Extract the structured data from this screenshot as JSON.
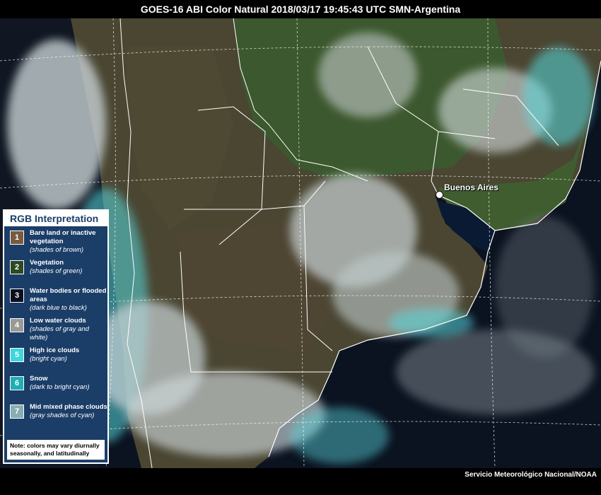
{
  "title": "GOES-16 ABI Color Natural 2018/03/17 19:45:43 UTC SMN-Argentina",
  "credit": "Servicio Meteorológico Nacional/NOAA",
  "city": {
    "label": "Buenos Aires"
  },
  "legend": {
    "title": "RGB Interpretation",
    "items": [
      {
        "number": "1",
        "label": "Bare land or inactive vegetation",
        "desc": "(shades of brown)",
        "color": "#7a5a3e"
      },
      {
        "number": "2",
        "label": "Vegetation",
        "desc": "(shades of green)",
        "color": "#2e4a24"
      },
      {
        "number": "3",
        "label": "Water bodies or flooded areas",
        "desc": "(dark blue to black)",
        "color": "#0a0f1e"
      },
      {
        "number": "4",
        "label": "Low water clouds",
        "desc": "(shades of gray and white)",
        "color": "#9a9a98"
      },
      {
        "number": "5",
        "label": "High ice  clouds",
        "desc": "(bright cyan)",
        "color": "#3fd6dc"
      },
      {
        "number": "6",
        "label": "Snow",
        "desc": "(dark to bright cyan)",
        "color": "#1eaeb4"
      },
      {
        "number": "7",
        "label": "Mid mixed phase clouds",
        "desc": "(gray shades of cyan)",
        "color": "#86aeb0"
      }
    ],
    "note": "Note: colors may vary diurnally seasonally, and latitudinally"
  },
  "colors": {
    "land_brown": "#5a4a36",
    "vegetation_green": "#3e5a30",
    "ocean": "#0b1220",
    "cloud_white": "#c9d2d4",
    "cloud_cyan": "#56d8de",
    "legend_bg": "#1b3e68"
  }
}
